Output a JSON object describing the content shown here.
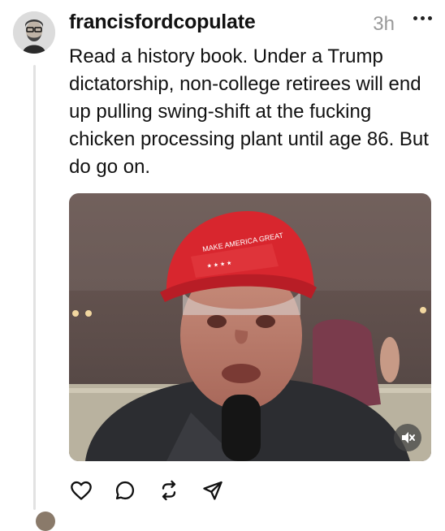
{
  "post": {
    "username": "francisfordcopulate",
    "time": "3h",
    "text": "Read a history book. Under a Trump dictatorship, non-college retirees will end up pulling swing-shift at the fucking chicken processing plant until age 86. But do go on."
  },
  "media": {
    "type": "video",
    "muted": true
  },
  "icons": {
    "more": "more-icon",
    "mute": "speaker-muted-icon",
    "like": "heart-icon",
    "comment": "comment-icon",
    "repost": "repost-icon",
    "share": "send-icon"
  }
}
